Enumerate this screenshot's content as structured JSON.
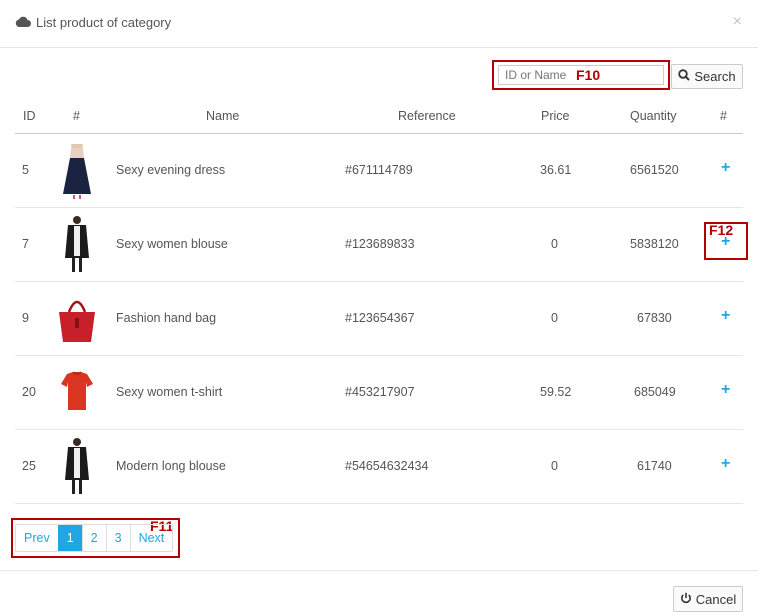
{
  "header": {
    "title": "List product of category",
    "cloud_icon": "cloud-icon",
    "close_label": "×"
  },
  "search": {
    "placeholder": "ID or Name",
    "button_label": "Search",
    "annotation": "F10"
  },
  "table": {
    "columns": [
      "ID",
      "#",
      "Name",
      "Reference",
      "Price",
      "Quantity",
      "#"
    ],
    "rows": [
      {
        "id": "5",
        "name": "Sexy evening dress",
        "reference": "#671114789",
        "price": "36.61",
        "quantity": "6561520",
        "thumb": "evening-dress"
      },
      {
        "id": "7",
        "name": "Sexy women blouse",
        "reference": "#123689833",
        "price": "0",
        "quantity": "5838120",
        "thumb": "long-blouse"
      },
      {
        "id": "9",
        "name": "Fashion hand bag",
        "reference": "#123654367",
        "price": "0",
        "quantity": "67830",
        "thumb": "red-handbag"
      },
      {
        "id": "20",
        "name": "Sexy women t-shirt",
        "reference": "#453217907",
        "price": "59.52",
        "quantity": "685049",
        "thumb": "red-tshirt"
      },
      {
        "id": "25",
        "name": "Modern long blouse",
        "reference": "#54654632434",
        "price": "0",
        "quantity": "61740",
        "thumb": "long-blouse"
      }
    ],
    "add_glyph": "+",
    "add_annotation": "F12"
  },
  "pagination": {
    "prev": "Prev",
    "pages": [
      "1",
      "2",
      "3"
    ],
    "active_page": "1",
    "next": "Next",
    "annotation": "F11"
  },
  "footer": {
    "cancel_label": "Cancel"
  },
  "colors": {
    "accent": "#1fa7e3",
    "annotation": "#b30000"
  }
}
